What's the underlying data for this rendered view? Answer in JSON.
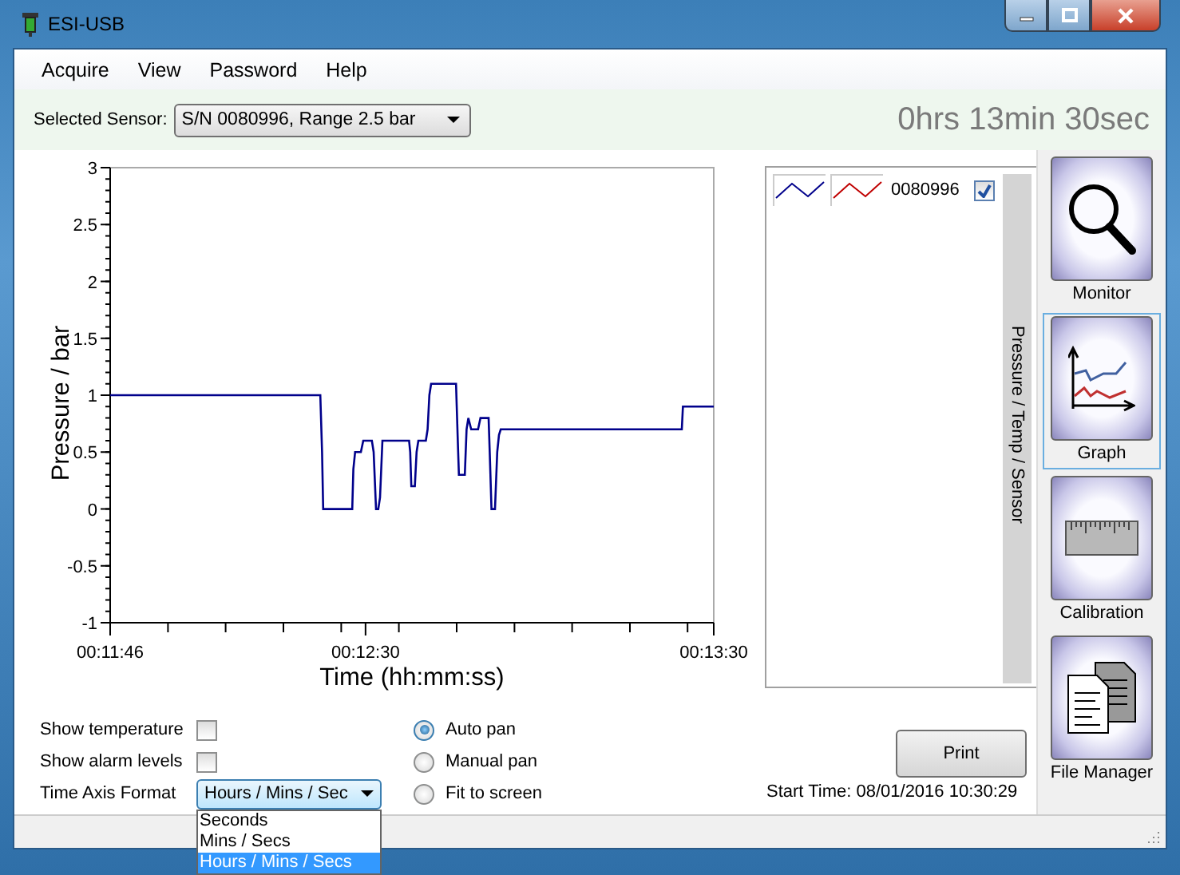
{
  "window": {
    "title": "ESI-USB"
  },
  "menu": [
    "Acquire",
    "View",
    "Password",
    "Help"
  ],
  "sensor": {
    "label": "Selected Sensor:",
    "value": "S/N 0080996, Range 2.5 bar"
  },
  "elapsed": "0hrs 13min 30sec",
  "graph": {
    "chart_data": {
      "type": "line",
      "xlabel": "Time (hh:mm:ss)",
      "ylabel": "Pressure / bar",
      "x": [
        706,
        742.2,
        742.5,
        742.7,
        747.7,
        747.9,
        748.2,
        749.2,
        749.6,
        751.1,
        751.4,
        751.8,
        752.2,
        752.5,
        752.9,
        757.5,
        757.7,
        757.9,
        758.5,
        758.8,
        759.1,
        760.4,
        760.7,
        761.0,
        761.3,
        765.6,
        765.9,
        766.1,
        767.1,
        767.4,
        767.7,
        768.2,
        769.4,
        769.8,
        771.2,
        771.4,
        771.7,
        772.3,
        772.7,
        773.0,
        773.3,
        804.5,
        804.7,
        810
      ],
      "series": [
        {
          "color": "#00008b",
          "values": [
            1,
            1,
            0.5,
            0,
            0,
            0.35,
            0.5,
            0.5,
            0.6,
            0.6,
            0.5,
            0,
            0,
            0.1,
            0.6,
            0.6,
            0.5,
            0.2,
            0.2,
            0.5,
            0.6,
            0.6,
            0.7,
            1.0,
            1.1,
            1.1,
            0.6,
            0.3,
            0.3,
            0.7,
            0.8,
            0.7,
            0.7,
            0.8,
            0.8,
            0.5,
            0,
            0,
            0.5,
            0.65,
            0.7,
            0.7,
            0.9,
            0.9
          ]
        }
      ],
      "xlim": [
        706,
        810
      ],
      "ylim": [
        -1,
        3
      ],
      "xticks": [
        {
          "value": 706,
          "label": "00:11:46"
        },
        {
          "value": 750,
          "label": "00:12:30"
        },
        {
          "value": 810,
          "label": "00:13:30"
        }
      ],
      "yticks": [
        -1,
        -0.5,
        0,
        0.5,
        1,
        1.5,
        2,
        2.5,
        3
      ]
    }
  },
  "legend": {
    "items": [
      {
        "label": "0080996",
        "checked": true
      }
    ],
    "tab": "Pressure / Temp / Sensor"
  },
  "nav": [
    {
      "label": "Monitor",
      "kind": "monitor",
      "selected": false
    },
    {
      "label": "Graph",
      "kind": "graph",
      "selected": true
    },
    {
      "label": "Calibration",
      "kind": "calibration",
      "selected": false
    },
    {
      "label": "File Manager",
      "kind": "files",
      "selected": false
    }
  ],
  "options": {
    "checkboxes": [
      {
        "label": "Show temperature",
        "checked": false
      },
      {
        "label": "Show alarm levels",
        "checked": false
      }
    ],
    "time_axis": {
      "label": "Time Axis Format",
      "value": "Hours / Mins / Sec",
      "expanded": true,
      "options": [
        {
          "label": "Seconds",
          "selected": false
        },
        {
          "label": "Mins / Secs",
          "selected": false
        },
        {
          "label": "Hours / Mins / Secs",
          "selected": true
        }
      ]
    }
  },
  "pan": [
    {
      "label": "Auto pan",
      "selected": true
    },
    {
      "label": "Manual pan",
      "selected": false
    },
    {
      "label": "Fit to screen",
      "selected": false
    }
  ],
  "print_button": "Print",
  "start_time": "Start Time: 08/01/2016 10:30:29"
}
